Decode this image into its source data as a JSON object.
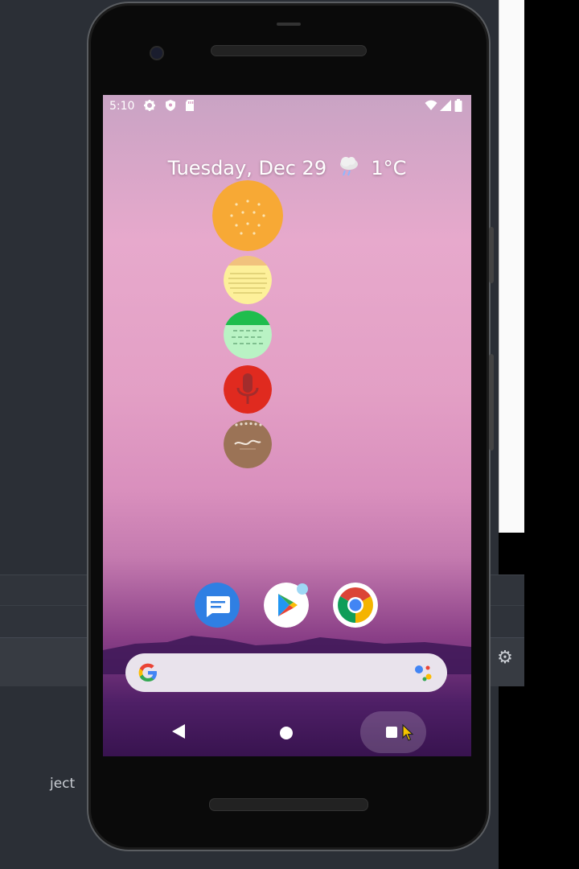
{
  "status_bar": {
    "time": "5:10",
    "icons": [
      "settings-icon",
      "shield-icon",
      "sd-card-icon",
      "wifi-icon",
      "signal-icon",
      "battery-icon"
    ]
  },
  "widget": {
    "date": "Tuesday, Dec 29",
    "weather_icon": "cloud-rain-icon",
    "temperature": "1°C"
  },
  "app_circles": [
    {
      "name": "cookie-app",
      "color": "#f7a935"
    },
    {
      "name": "notes-app",
      "color": "#fdf09a"
    },
    {
      "name": "calendar-app",
      "color": "#b9f3c4"
    },
    {
      "name": "voice-recorder-app",
      "color": "#e02a1f"
    },
    {
      "name": "notebook-app",
      "color": "#9b7356"
    }
  ],
  "dock": [
    {
      "name": "messages-app",
      "color": "#2f7fe3"
    },
    {
      "name": "play-store-app",
      "color": "#ffffff"
    },
    {
      "name": "chrome-app",
      "color": "#ffffff"
    }
  ],
  "nav": [
    "back-button",
    "home-button",
    "recents-button"
  ],
  "ide": {
    "partial_text": "ject"
  }
}
